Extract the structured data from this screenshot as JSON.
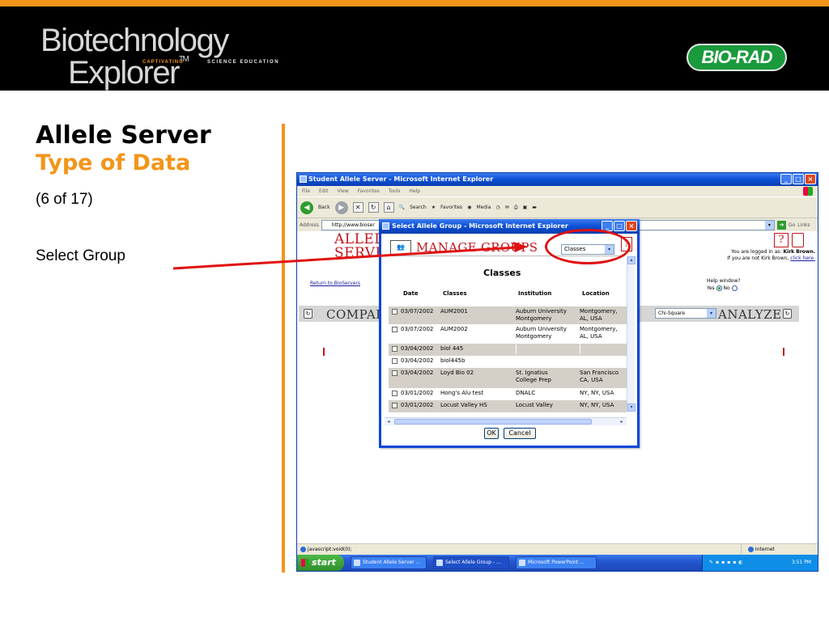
{
  "header": {
    "logo_line1": "Biotechnology",
    "logo_line2": "Explorer",
    "logo_tm": "TM",
    "tag_captivating": "CAPTIVATING",
    "tag_science": "SCIENCE EDUCATION",
    "brand": "BIO-RAD",
    "accent_color": "#f39519",
    "brand_color": "#1a9a3c"
  },
  "slide": {
    "title": "Allele Server",
    "subtitle": "Type of Data",
    "count": "(6 of 17)",
    "step": "Select Group"
  },
  "ie": {
    "window_title": "Student Allele Server - Microsoft Internet Explorer",
    "menu": [
      "File",
      "Edit",
      "View",
      "Favorites",
      "Tools",
      "Help"
    ],
    "toolbar": {
      "back": "Back",
      "search": "Search",
      "favorites": "Favorites",
      "media": "Media"
    },
    "address_label": "Address",
    "address_value": "http://www.bioser",
    "go": "Go",
    "links": "Links",
    "page": {
      "title_line1": "ALLELE",
      "title_line2": "SERVER",
      "return_link": "Return to BioServers",
      "login_line1_prefix": "You are logged in as: ",
      "login_user": "Kirk Brown.",
      "login_line2_prefix": "If you are not Kirk Brown, ",
      "login_link": "click here.",
      "help_window": "Help window?",
      "help_yes": "Yes",
      "help_no": "No",
      "compare": "COMPARE",
      "analysis_select": "Chi-Square",
      "analyze": "ANALYZE"
    },
    "status_left": "javascript:void(0);",
    "status_right": "Internet"
  },
  "taskbar": {
    "start": "start",
    "items": [
      "Student Allele Server ...",
      "Select Allele Group - ...",
      "Microsoft PowerPoint ..."
    ],
    "clock": "3:51 PM"
  },
  "dialog": {
    "title": "Select Allele Group - Microsoft Internet Explorer",
    "manage_groups": "MANAGE GROUPS",
    "group_type": "Classes",
    "heading": "Classes",
    "columns": [
      "Date",
      "Classes",
      "Institution",
      "Location"
    ],
    "rows": [
      {
        "date": "03/07/2002",
        "class": "AUM2001",
        "inst1": "Auburn University",
        "inst2": "Montgomery",
        "loc1": "Montgomery,",
        "loc2": "AL, USA"
      },
      {
        "date": "03/07/2002",
        "class": "AUM2002",
        "inst1": "Auburn University",
        "inst2": "Montgomery",
        "loc1": "Montgomery,",
        "loc2": "AL, USA"
      },
      {
        "date": "03/04/2002",
        "class": "biol 445",
        "inst1": "",
        "inst2": "",
        "loc1": "",
        "loc2": ""
      },
      {
        "date": "03/04/2002",
        "class": "biol445b",
        "inst1": "",
        "inst2": "",
        "loc1": "",
        "loc2": ""
      },
      {
        "date": "03/04/2002",
        "class": "Loyd Bio 02",
        "inst1": "St. Ignatius",
        "inst2": "College Prep",
        "loc1": "San Francisco",
        "loc2": "CA, USA"
      },
      {
        "date": "03/01/2002",
        "class": "Hong's Alu test",
        "inst1": "DNALC",
        "inst2": "",
        "loc1": "NY, NY, USA",
        "loc2": ""
      },
      {
        "date": "03/01/2002",
        "class": "Locust Valley HS",
        "inst1": "Locust Valley",
        "inst2": "",
        "loc1": "NY, NY, USA",
        "loc2": ""
      }
    ],
    "ok": "OK",
    "cancel": "Cancel"
  }
}
